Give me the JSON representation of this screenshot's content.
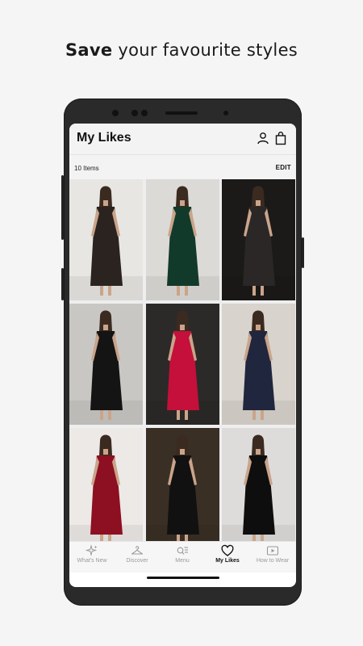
{
  "headline": {
    "bold": "Save",
    "rest": "your favourite styles"
  },
  "app": {
    "title": "My Likes",
    "item_count": "10 Items",
    "edit_label": "EDIT",
    "header_icons": [
      "user-icon",
      "bag-icon"
    ]
  },
  "products": [
    {
      "name": "sequin-mini-dress",
      "bg": "#e8e6e3",
      "dress": "#2b2320"
    },
    {
      "name": "green-midi-dress",
      "bg": "#dcdad6",
      "dress": "#123a2a"
    },
    {
      "name": "sparkle-wrap-dress",
      "bg": "#1c1a18",
      "dress": "#2a2726"
    },
    {
      "name": "black-one-shoulder-gown",
      "bg": "#c9c7c4",
      "dress": "#141414"
    },
    {
      "name": "red-wrap-maxi-dress",
      "bg": "#2b2a28",
      "dress": "#c4103a"
    },
    {
      "name": "navy-floral-maxi-dress",
      "bg": "#d8d3cc",
      "dress": "#20263d"
    },
    {
      "name": "burgundy-halter-dress",
      "bg": "#ece9e6",
      "dress": "#8d0f22"
    },
    {
      "name": "black-wrap-dress-bar",
      "bg": "#3a2f25",
      "dress": "#111111"
    },
    {
      "name": "black-halter-swing-dress",
      "bg": "#dedcda",
      "dress": "#0e0e0e"
    }
  ],
  "nav": [
    {
      "label": "What's New",
      "icon": "sparkle-icon",
      "active": false
    },
    {
      "label": "Discover",
      "icon": "hanger-icon",
      "active": false
    },
    {
      "label": "Menu",
      "icon": "menu-icon",
      "active": false
    },
    {
      "label": "My Likes",
      "icon": "heart-icon",
      "active": true
    },
    {
      "label": "How to Wear",
      "icon": "play-icon",
      "active": false
    }
  ]
}
